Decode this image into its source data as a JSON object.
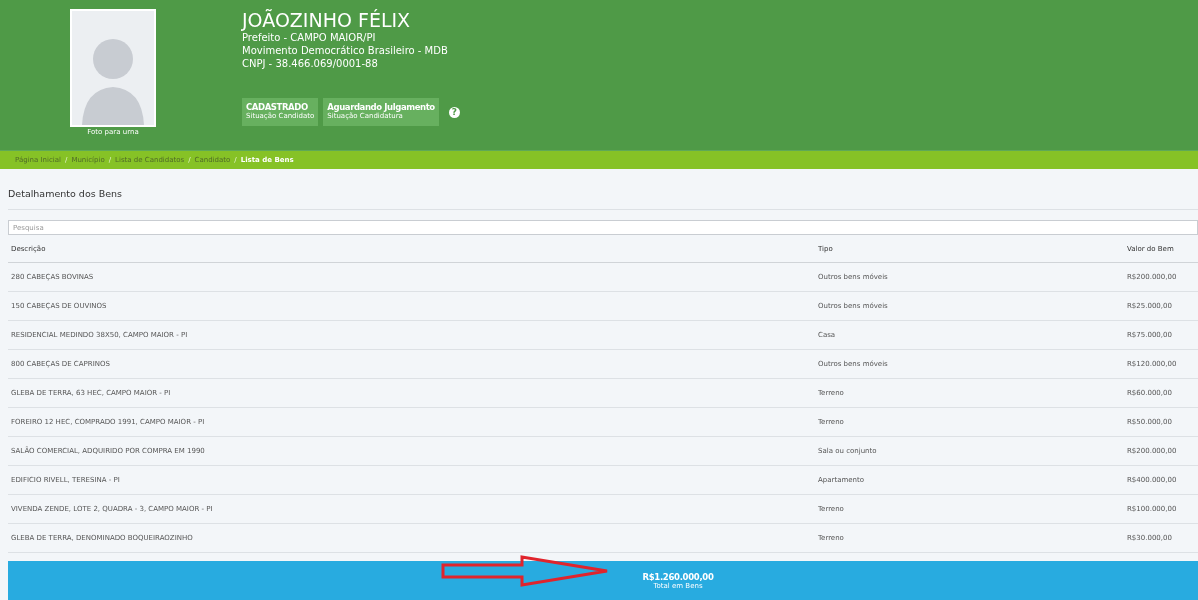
{
  "candidate": {
    "photo_caption": "Foto para urna",
    "name": "JOÃOZINHO FÉLIX",
    "details": [
      "Prefeito - CAMPO MAIOR/PI",
      "Movimento Democrático Brasileiro - MDB",
      "CNPJ - 38.466.069/0001-88"
    ],
    "badges": [
      {
        "title": "CADASTRADO",
        "subtitle": "Situação Candidato"
      },
      {
        "title": "Aguardando Julgamento",
        "subtitle": "Situação Candidatura"
      }
    ],
    "help_icon": "?"
  },
  "breadcrumb": [
    {
      "label": "Página Inicial",
      "current": false
    },
    {
      "label": "Município",
      "current": false
    },
    {
      "label": "Lista de Candidatos",
      "current": false
    },
    {
      "label": "Candidato",
      "current": false
    },
    {
      "label": "Lista de Bens",
      "current": true
    }
  ],
  "breadcrumb_separator": "/",
  "section_title": "Detalhamento dos Bens",
  "search": {
    "placeholder": "Pesquisa"
  },
  "table": {
    "columns": [
      "Descrição",
      "Tipo",
      "Valor do Bem"
    ],
    "rows": [
      [
        "280 CABEÇAS BOVINAS",
        "Outros bens móveis",
        "R$200.000,00"
      ],
      [
        "150 CABEÇAS DE OUVINOS",
        "Outros bens móveis",
        "R$25.000,00"
      ],
      [
        "RESIDENCIAL MEDINDO 38X50, CAMPO MAIOR - PI",
        "Casa",
        "R$75.000,00"
      ],
      [
        "800 CABEÇAS DE CAPRINOS",
        "Outros bens móveis",
        "R$120.000,00"
      ],
      [
        "GLEBA DE TERRA, 63 HEC, CAMPO MAIOR - PI",
        "Terreno",
        "R$60.000,00"
      ],
      [
        "FOREIRO 12 HEC, COMPRADO 1991, CAMPO MAIOR - PI",
        "Terreno",
        "R$50.000,00"
      ],
      [
        "SALÃO COMERCIAL, ADQUIRIDO POR COMPRA EM 1990",
        "Sala ou conjunto",
        "R$200.000,00"
      ],
      [
        "EDIFICIO RIVELL, TERESINA - PI",
        "Apartamento",
        "R$400.000,00"
      ],
      [
        "VIVENDA ZENDE, LOTE 2, QUADRA - 3, CAMPO MAIOR - PI",
        "Terreno",
        "R$100.000,00"
      ],
      [
        "GLEBA DE TERRA, DENOMINADO BOQUEIRAOZINHO",
        "Terreno",
        "R$30.000,00"
      ]
    ]
  },
  "total": {
    "value": "R$1.260.000,00",
    "label": "Total em Bens"
  }
}
